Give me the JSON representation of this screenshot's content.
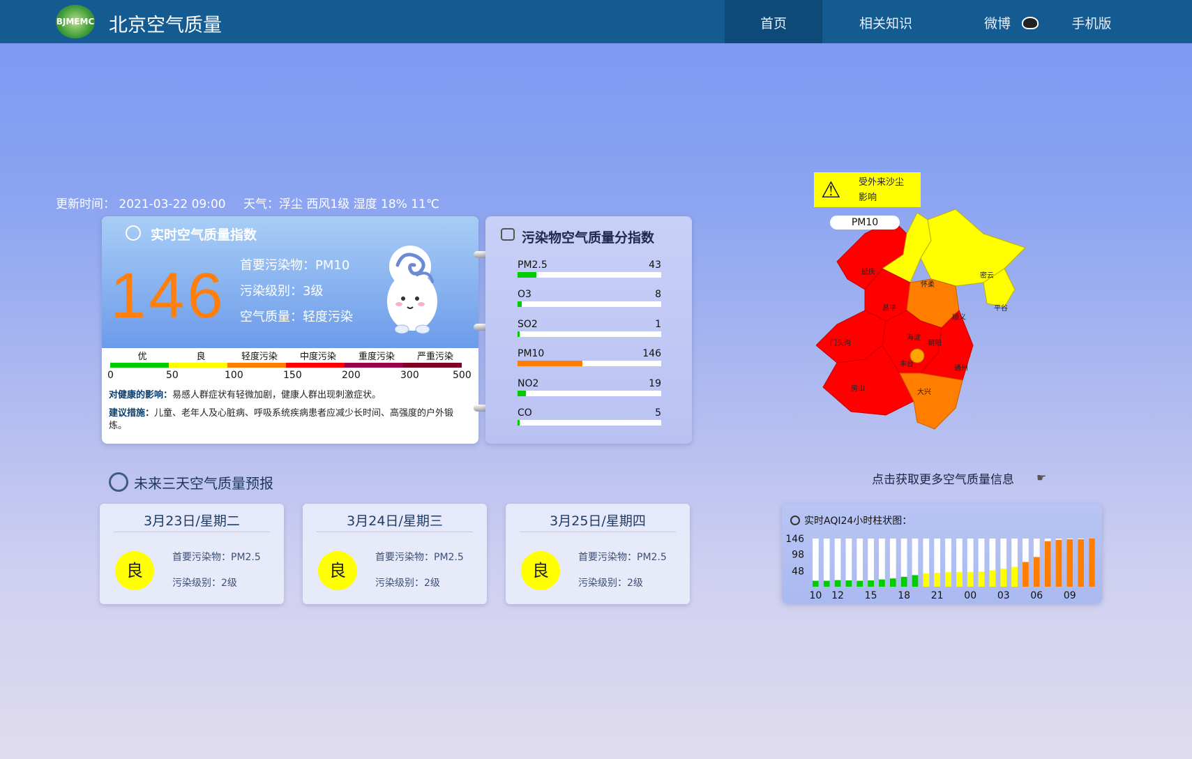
{
  "header": {
    "logo_text": "BJMEMC",
    "site_title": "北京空气质量",
    "nav": [
      {
        "label": "首页",
        "active": true
      },
      {
        "label": "相关知识",
        "active": false
      },
      {
        "label": "微博",
        "active": false
      },
      {
        "label": "手机版",
        "active": false
      }
    ]
  },
  "update": {
    "time": "更新时间： 2021-03-22 09:00",
    "weather": "天气：浮尘 西风1级 湿度 18% 11℃"
  },
  "aqi": {
    "title": "实时空气质量指数",
    "value": "146",
    "primary": "首要污染物：PM10",
    "level": "污染级别：3级",
    "quality": "空气质量：轻度污染",
    "scale_labels": [
      "优",
      "良",
      "轻度污染",
      "中度污染",
      "重度污染",
      "严重污染"
    ],
    "scale_colors": [
      "#00cc00",
      "#ffff00",
      "#ff7e00",
      "#ff0000",
      "#99004c",
      "#7e0023"
    ],
    "scale_nums": [
      "0",
      "50",
      "100",
      "150",
      "200",
      "300",
      "500"
    ],
    "health_label": "对健康的影响：",
    "health_text": "易感人群症状有轻微加剧，健康人群出现刺激症状。",
    "advice_label": "建议措施：",
    "advice_text": "儿童、老年人及心脏病、呼吸系统疾病患者应减少长时间、高强度的户外锻炼。"
  },
  "pollutants": {
    "title": "污染物空气质量分指数",
    "items": [
      {
        "name": "PM2.5",
        "value": "43",
        "fraction": 0.13,
        "color": "#00cc00"
      },
      {
        "name": "O3",
        "value": "8",
        "fraction": 0.03,
        "color": "#00cc00"
      },
      {
        "name": "SO2",
        "value": "1",
        "fraction": 0.01,
        "color": "#00cc00"
      },
      {
        "name": "PM10",
        "value": "146",
        "fraction": 0.45,
        "color": "#ff7e00"
      },
      {
        "name": "NO2",
        "value": "19",
        "fraction": 0.06,
        "color": "#00cc00"
      },
      {
        "name": "CO",
        "value": "5",
        "fraction": 0.015,
        "color": "#00cc00"
      }
    ]
  },
  "forecast": {
    "title": "未来三天空气质量预报",
    "days": [
      {
        "date": "3月23日/星期二",
        "grade": "良",
        "primary": "首要污染物：PM2.5",
        "level": "污染级别：2级"
      },
      {
        "date": "3月24日/星期三",
        "grade": "良",
        "primary": "首要污染物：PM2.5",
        "level": "污染级别：2级"
      },
      {
        "date": "3月25日/星期四",
        "grade": "良",
        "primary": "首要污染物：PM2.5",
        "level": "污染级别：2级"
      }
    ]
  },
  "map": {
    "warning_line1": "受外来沙尘",
    "warning_line2": "影响",
    "pollutant_pill": "PM10",
    "district_labels": [
      "延庆",
      "怀柔",
      "密云",
      "平谷",
      "昌平",
      "顺义",
      "门头沟",
      "海淀",
      "朝阳",
      "丰台",
      "通州",
      "房山",
      "大兴"
    ],
    "link_text": "点击获取更多空气质量信息"
  },
  "chart_data": {
    "type": "bar",
    "title": "实时AQI24小时柱状图：",
    "y_ticks": [
      "146",
      "98",
      "48"
    ],
    "x_tick_labels": [
      "10",
      "12",
      "15",
      "18",
      "21",
      "00",
      "03",
      "06",
      "09"
    ],
    "ylim": [
      0,
      146
    ],
    "values": [
      18,
      18,
      20,
      19,
      18,
      19,
      22,
      25,
      30,
      35,
      40,
      42,
      44,
      44,
      44,
      46,
      50,
      55,
      60,
      75,
      90,
      138,
      142,
      144,
      144,
      146
    ],
    "colors": [
      "#00cc00",
      "#00cc00",
      "#00cc00",
      "#00cc00",
      "#00cc00",
      "#00cc00",
      "#00cc00",
      "#00cc00",
      "#00cc00",
      "#00cc00",
      "#ffff00",
      "#ffff00",
      "#ffff00",
      "#ffff00",
      "#ffff00",
      "#ffff00",
      "#ffff00",
      "#ffff00",
      "#ffff00",
      "#ff7e00",
      "#ff7e00",
      "#ff7e00",
      "#ff7e00",
      "#ff7e00",
      "#ff7e00",
      "#ff7e00"
    ]
  }
}
